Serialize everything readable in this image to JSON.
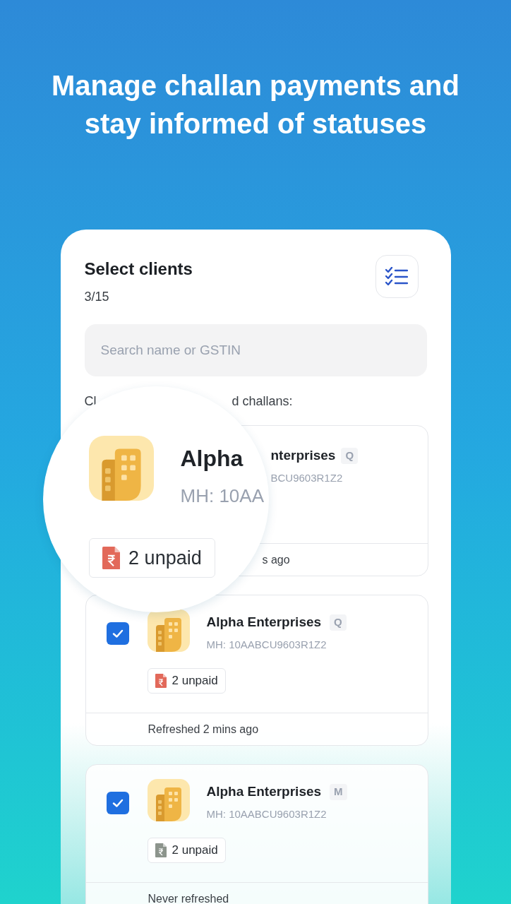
{
  "headline": "Manage challan payments and stay informed of statuses",
  "panel": {
    "title": "Select clients",
    "count": "3/15",
    "search": {
      "placeholder": "Search name or GSTIN"
    },
    "section_label": [
      "Cl",
      "d challans:"
    ],
    "clients": [
      {
        "kind": "covered",
        "name": "nterprises",
        "tag": "Q",
        "gstin": "BCU9603R1Z2",
        "refreshed": "s ago"
      },
      {
        "kind": "full",
        "checked": true,
        "name": "Alpha Enterprises",
        "tag": "Q",
        "gstin": "MH: 10AABCU9603R1Z2",
        "unpaid": "2 unpaid",
        "color": "#e2695a",
        "refreshed": "Refreshed 2 mins ago"
      },
      {
        "kind": "full",
        "checked": true,
        "name": "Alpha Enterprises",
        "tag": "M",
        "gstin": "MH: 10AABCU9603R1Z2",
        "unpaid": "2 unpaid",
        "color": "#8c948c",
        "refreshed": "Never refreshed"
      }
    ]
  },
  "magnifier": {
    "name": "Alpha",
    "gstin": "MH: 10AA",
    "unpaid": "2 unpaid",
    "color": "#e2695a"
  }
}
